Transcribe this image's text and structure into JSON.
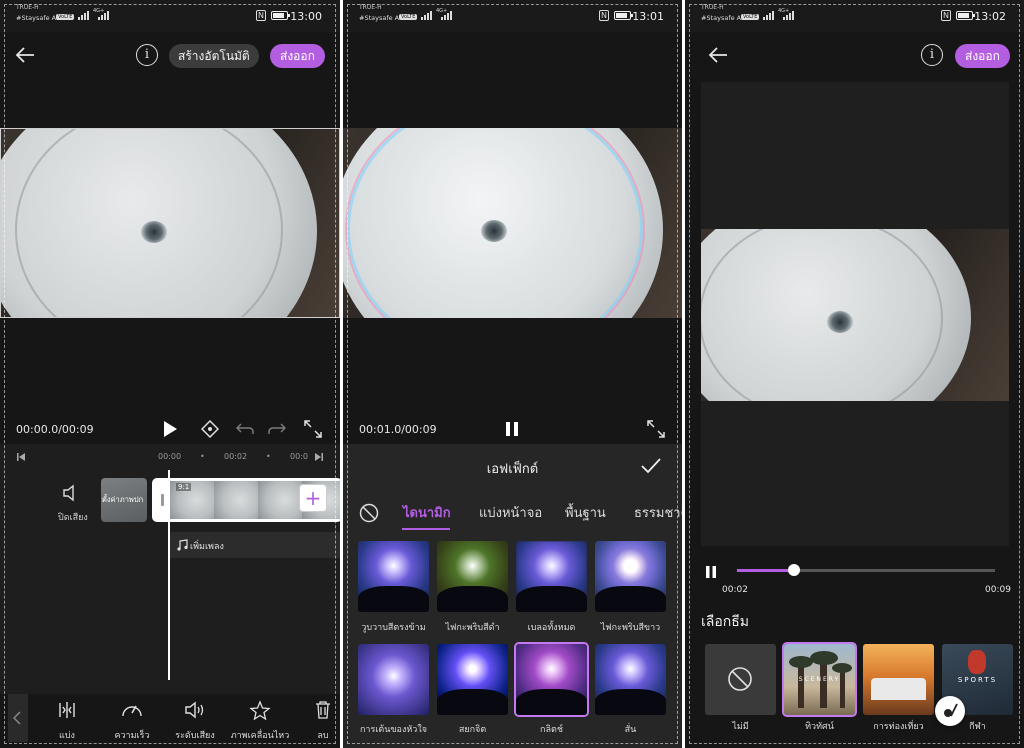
{
  "status": [
    {
      "carrier": "TRUE-H",
      "network": "#Staysafe AIS",
      "badge": "VoLTE",
      "signal": "4G+",
      "time": "13:00"
    },
    {
      "carrier": "TRUE-H",
      "network": "#Staysafe AIS",
      "badge": "VoLTE",
      "signal": "4G+",
      "time": "13:01"
    },
    {
      "carrier": "TRUE-H",
      "network": "#Staysafe AIS",
      "badge": "VoLTE",
      "signal": "4G+",
      "time": "13:02"
    }
  ],
  "screen1": {
    "auto_create": "สร้างอัตโนมัติ",
    "export": "ส่งออก",
    "timecode": "00:00.0/00:09",
    "ruler": [
      "00:00",
      "00:02",
      "00:0"
    ],
    "mute_label": "ปิดเสียง",
    "cover_label": "ตั้งค่าภาพปก",
    "clip_ratio": "9:1",
    "add_music": "เพิ่มเพลง",
    "tools": [
      {
        "label": "แบ่ง",
        "icon": "split-icon"
      },
      {
        "label": "ความเร็ว",
        "icon": "speed-icon"
      },
      {
        "label": "ระดับเสียง",
        "icon": "volume-icon"
      },
      {
        "label": "ภาพเคลื่อนไหว",
        "icon": "animation-icon"
      },
      {
        "label": "ลบ",
        "icon": "trash-icon"
      }
    ]
  },
  "screen2": {
    "timecode": "00:01.0/00:09",
    "panel_title": "เอฟเฟ็กต์",
    "tabs": [
      "ไดนามิก",
      "แบ่งหน้าจอ",
      "พื้นฐาน",
      "ธรรมชาติ"
    ],
    "effects": [
      {
        "label": "วูบวาบสีตรงข้าม"
      },
      {
        "label": "ไฟกะพริบสีดำ"
      },
      {
        "label": "เบลอทั้งหมด"
      },
      {
        "label": "ไฟกะพริบสีขาว"
      },
      {
        "label": "การเต้นของหัวใจ"
      },
      {
        "label": "สยกจิต"
      },
      {
        "label": "กลิตช์"
      },
      {
        "label": "สั่น"
      }
    ],
    "selected_effect": "กลิตช์"
  },
  "screen3": {
    "export": "ส่งออก",
    "current_time": "00:02",
    "total_time": "00:09",
    "progress": 0.22,
    "theme_title": "เลือกธีม",
    "themes": [
      {
        "label": "ไม่มี"
      },
      {
        "label": "ทิวทัศน์",
        "overlay": "SCENERY"
      },
      {
        "label": "การท่องเที่ยว"
      },
      {
        "label": "กีฬา",
        "overlay": "SPORTS"
      }
    ],
    "selected_theme": "ทิวทัศน์"
  },
  "colors": {
    "accent": "#b35ee0",
    "background": "#161616",
    "panel": "#262626"
  }
}
